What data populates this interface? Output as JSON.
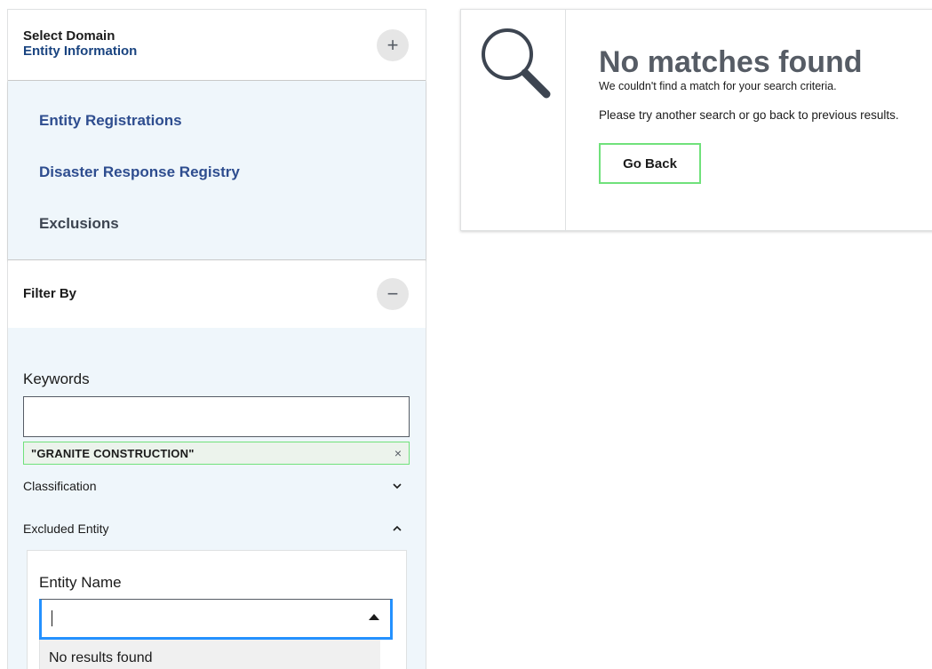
{
  "domain_selector": {
    "label": "Select Domain",
    "selected": "Entity Information",
    "toggle_symbol": "+",
    "items": [
      {
        "label": "Entity Registrations",
        "current": false
      },
      {
        "label": "Disaster Response Registry",
        "current": false
      },
      {
        "label": "Exclusions",
        "current": true
      }
    ]
  },
  "filters": {
    "title": "Filter By",
    "toggle_symbol": "−",
    "keywords": {
      "label": "Keywords",
      "value": "",
      "tag": "\"GRANITE CONSTRUCTION\"",
      "tag_remove": "×"
    },
    "classification": {
      "label": "Classification",
      "expanded": false
    },
    "excluded_entity": {
      "label": "Excluded Entity",
      "expanded": true,
      "entity_name": {
        "label": "Entity Name",
        "value": "",
        "no_results": "No results found"
      }
    }
  },
  "result": {
    "icon": "magnifying-glass-icon",
    "title": "No matches found",
    "message1": "We couldn't find a match for your search criteria.",
    "message2": "Please try another search or go back to previous results.",
    "button": "Go Back"
  },
  "colors": {
    "panel_bg": "#eff6fb",
    "link": "#2e4d8f",
    "tag_border": "#70e17b",
    "focus": "#2491ff"
  }
}
